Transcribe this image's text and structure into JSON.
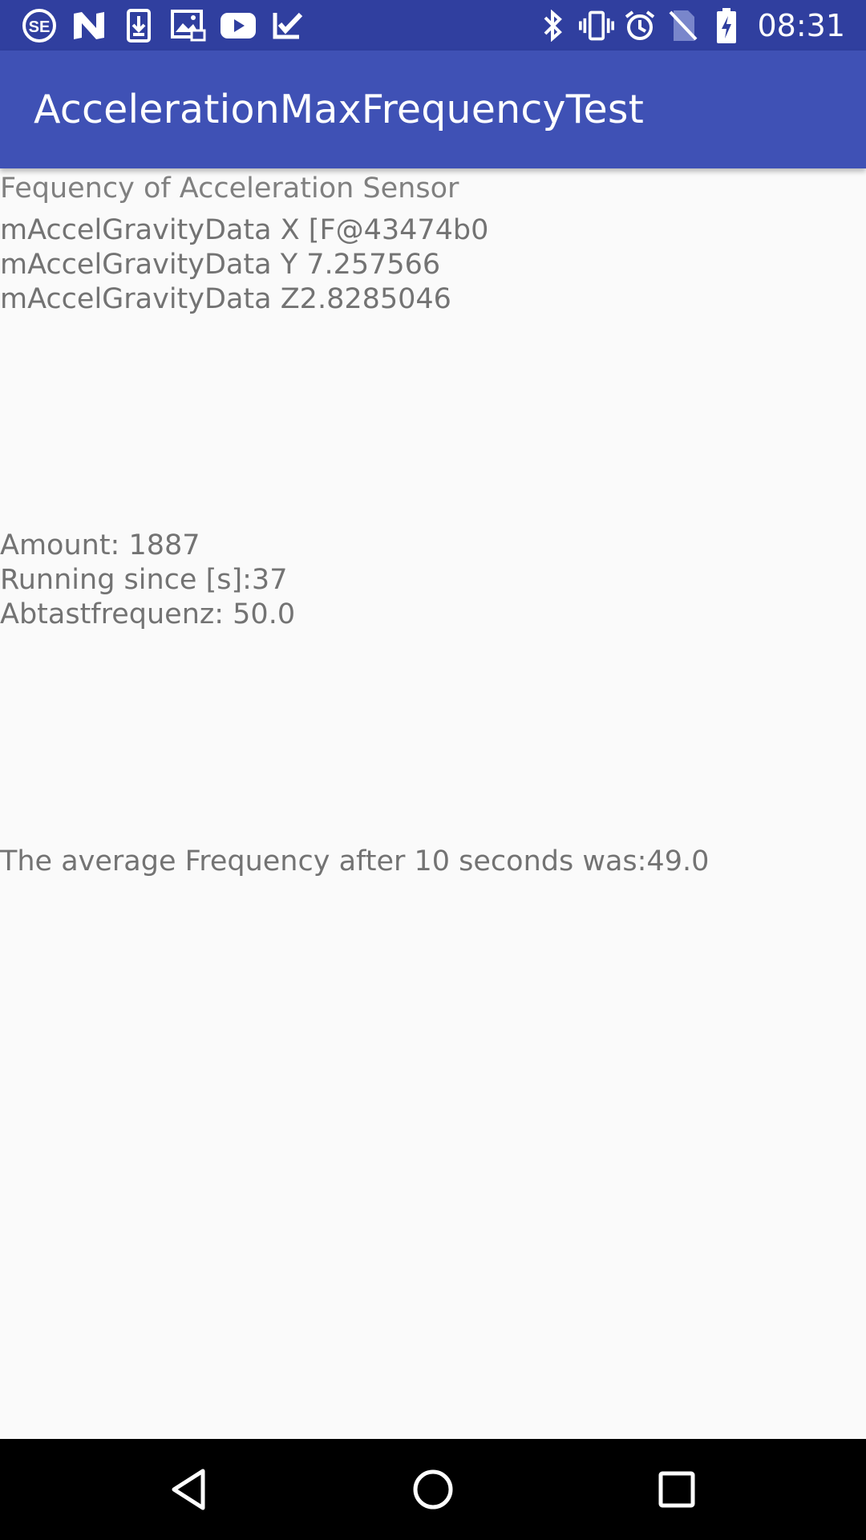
{
  "status_bar": {
    "time": "08:31",
    "left_icons": [
      "se-app-icon",
      "n-app-icon",
      "download-icon",
      "image-icon",
      "youtube-icon",
      "task-check-icon"
    ],
    "right_icons": [
      "bluetooth-icon",
      "vibrate-icon",
      "alarm-icon",
      "no-sim-icon",
      "battery-charging-icon"
    ],
    "color": "#303f9f"
  },
  "app_bar": {
    "title": "AccelerationMaxFrequencyTest",
    "color": "#3f51b5"
  },
  "content": {
    "header": "Fequency of Acceleration Sensor",
    "gravity_x": "mAccelGravityData X [F@43474b0",
    "gravity_y": "mAccelGravityData Y 7.257566",
    "gravity_z": "mAccelGravityData Z2.8285046",
    "amount": "Amount: 1887",
    "running_since": "Running since [s]:37",
    "sampling_frequency": "Abtastfrequenz: 50.0",
    "average_frequency": "The average Frequency after 10 seconds was:49.0"
  },
  "nav_bar": {
    "buttons": [
      "back-icon",
      "home-icon",
      "recents-icon"
    ]
  }
}
